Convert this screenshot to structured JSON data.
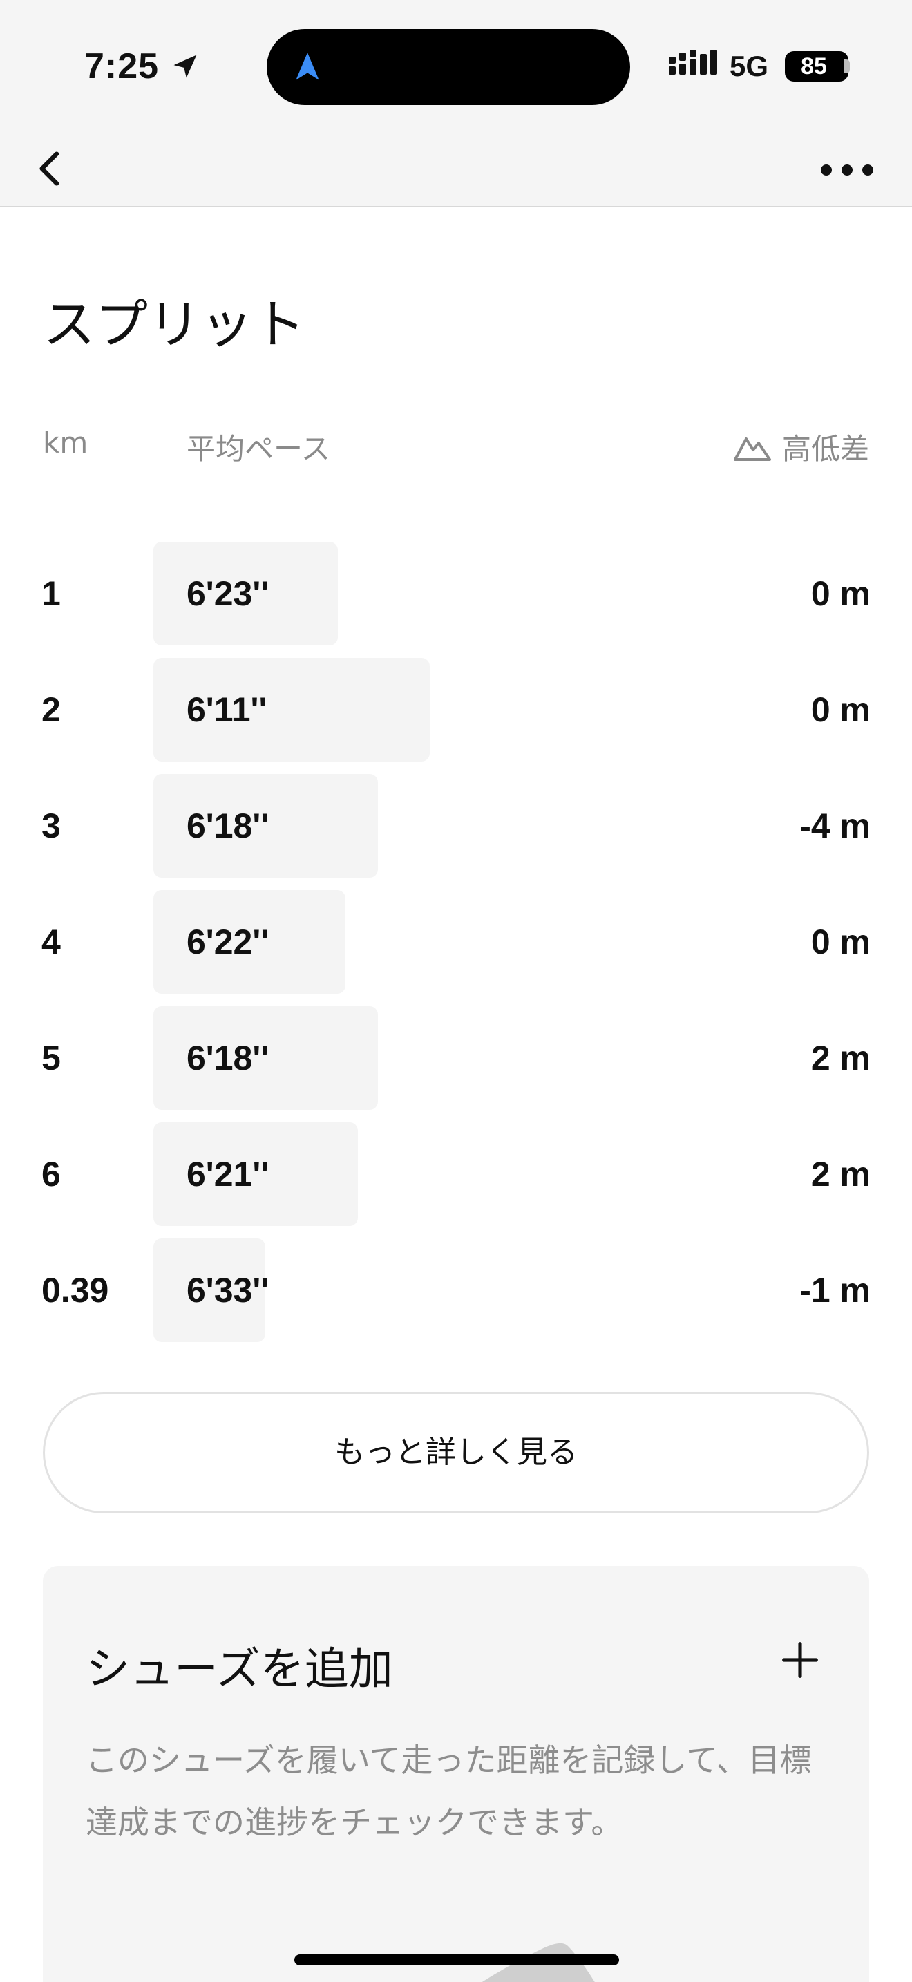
{
  "status_bar": {
    "time": "7:25",
    "network": "5G",
    "battery": "85"
  },
  "nav": {
    "back_icon": "chevron-left-icon",
    "more_icon": "ellipsis-icon"
  },
  "splits": {
    "title": "スプリット",
    "headers": {
      "km": "km",
      "pace": "平均ペース",
      "elevation": "高低差",
      "elevation_icon": "mountain-icon"
    },
    "rows": [
      {
        "km": "1",
        "pace": "6'23''",
        "elevation": "0 m",
        "bar_fill": 0.46
      },
      {
        "km": "2",
        "pace": "6'11''",
        "elevation": "0 m",
        "bar_fill": 0.69
      },
      {
        "km": "3",
        "pace": "6'18''",
        "elevation": "-4 m",
        "bar_fill": 0.56
      },
      {
        "km": "4",
        "pace": "6'22''",
        "elevation": "0 m",
        "bar_fill": 0.48
      },
      {
        "km": "5",
        "pace": "6'18''",
        "elevation": "2 m",
        "bar_fill": 0.56
      },
      {
        "km": "6",
        "pace": "6'21''",
        "elevation": "2 m",
        "bar_fill": 0.51
      },
      {
        "km": "0.39",
        "pace": "6'33''",
        "elevation": "-1 m",
        "bar_fill": 0.28
      }
    ],
    "more_button": "もっと詳しく見る"
  },
  "shoes": {
    "title": "シューズを追加",
    "add_icon": "plus-icon",
    "description": "このシューズを履いて走った距離を記録して、目標達成までの進捗をチェックできます。"
  },
  "colors": {
    "bar": "#f4f4f4",
    "accent_nav": "#3b8cf5",
    "muted_text": "#8a8a8a"
  }
}
